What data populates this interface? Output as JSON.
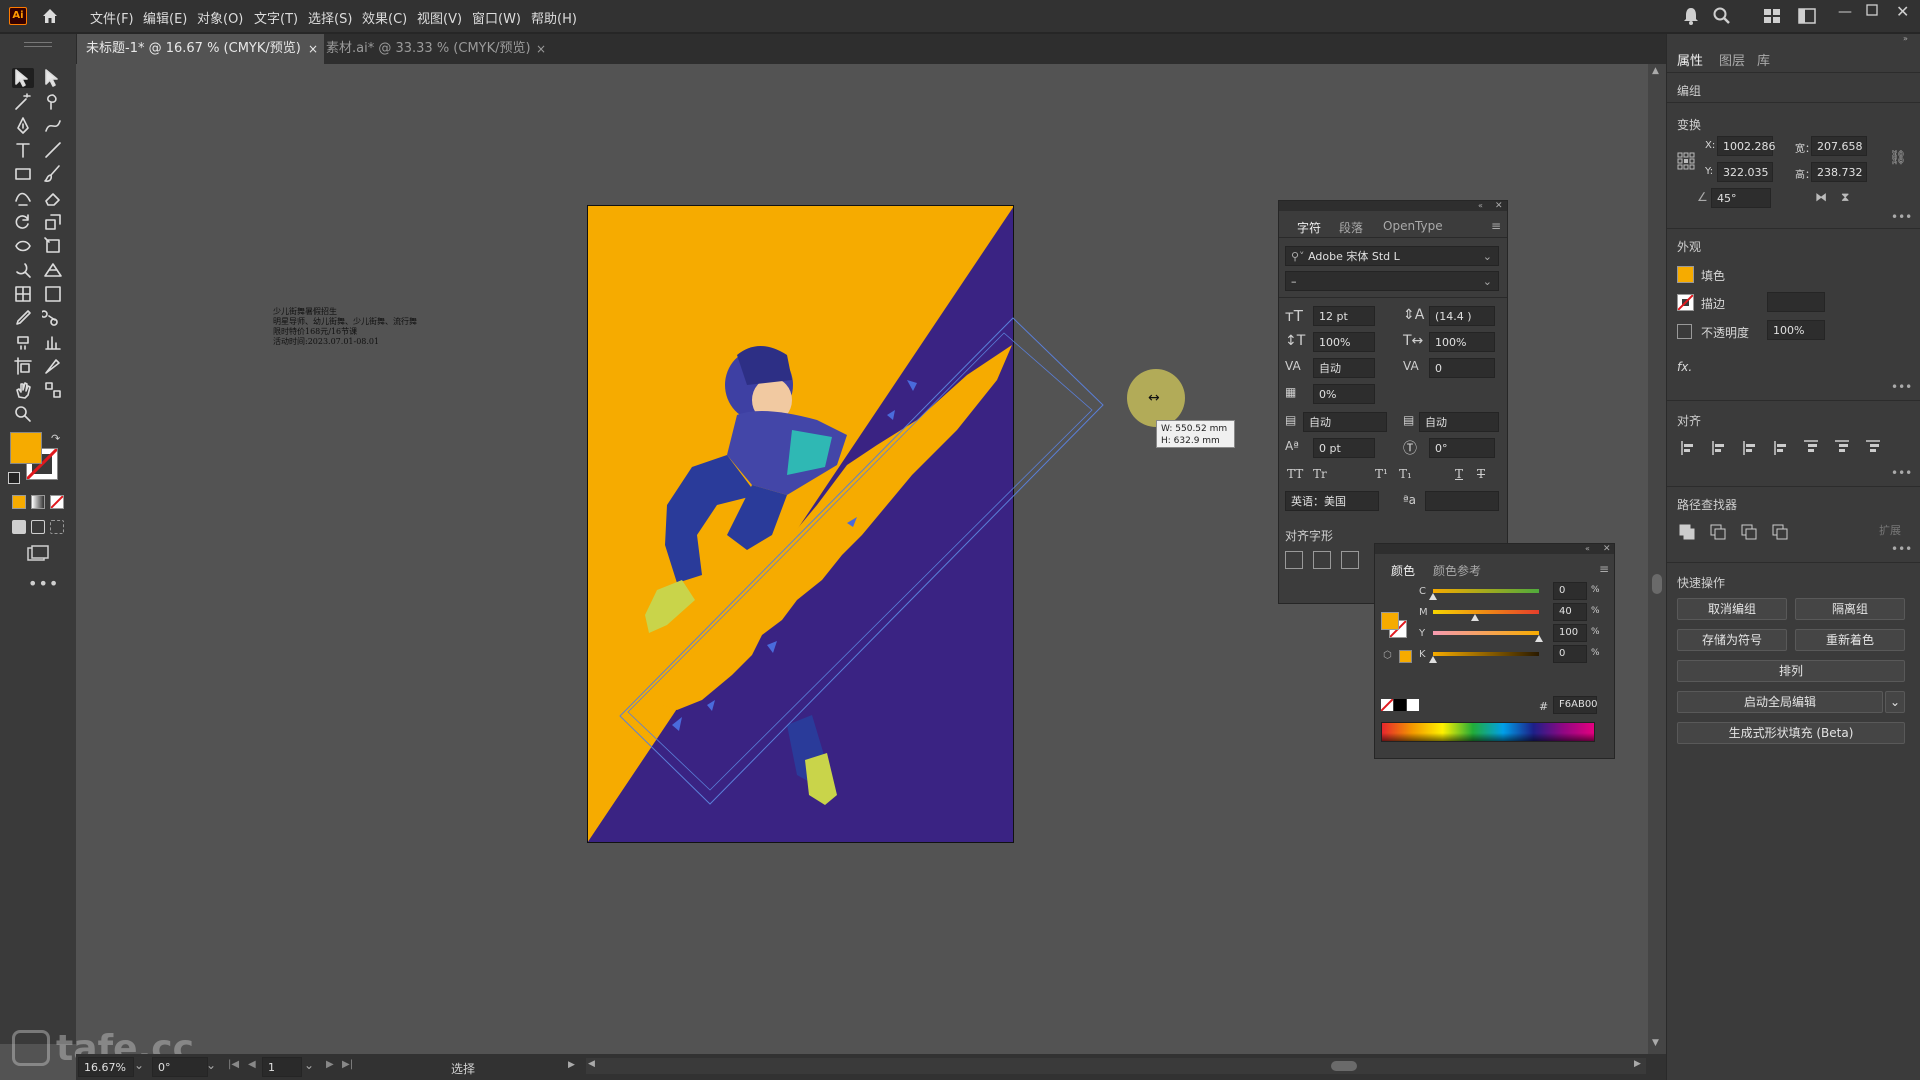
{
  "menu": {
    "app_logo": "Ai",
    "items": [
      "文件(F)",
      "编辑(E)",
      "对象(O)",
      "文字(T)",
      "选择(S)",
      "效果(C)",
      "视图(V)",
      "窗口(W)",
      "帮助(H)"
    ]
  },
  "tabs": [
    {
      "label": "未标题-1* @ 16.67 % (CMYK/预览)",
      "close": "×"
    },
    {
      "label": "素材.ai* @ 33.33 % (CMYK/预览)",
      "close": "×"
    }
  ],
  "canvas": {
    "side_text": [
      "少儿街舞暑假招生",
      "明星导师、幼儿街舞、少儿街舞、流行舞",
      "限时特价168元/16节课",
      "活动时间:2023.07.01-08.01"
    ],
    "size_tooltip": {
      "w": "W: 550.52 mm",
      "h": "H: 632.9 mm"
    },
    "colors": {
      "yellow": "#F6AB00",
      "purple": "#3A2383"
    }
  },
  "character_panel": {
    "tabs": [
      "字符",
      "段落",
      "OpenType"
    ],
    "font_family": "Adobe 宋体 Std L",
    "font_style": "–",
    "size": "12 pt",
    "leading": "(14.4 )",
    "v_scale": "100%",
    "h_scale": "100%",
    "kerning": "自动",
    "tracking": "0",
    "tsume": "0%",
    "aki_left": "自动",
    "aki_right": "自动",
    "baseline": "0 pt",
    "rotation": "0°",
    "language": "英语：美国",
    "align_glyph_label": "对齐字形"
  },
  "color_panel": {
    "tabs": [
      "颜色",
      "颜色参考"
    ],
    "channels": [
      {
        "name": "C",
        "value": "0",
        "unit": "%"
      },
      {
        "name": "M",
        "value": "40",
        "unit": "%"
      },
      {
        "name": "Y",
        "value": "100",
        "unit": "%"
      },
      {
        "name": "K",
        "value": "0",
        "unit": "%"
      }
    ],
    "hex_label": "#",
    "hex": "F6AB00"
  },
  "properties": {
    "tabs": [
      "属性",
      "图层",
      "库"
    ],
    "group_label": "编组",
    "transform_label": "变换",
    "x_label": "X:",
    "x": "1002.286",
    "y_label": "Y:",
    "y": "322.035",
    "w_label": "宽：",
    "w": "207.658",
    "h_label": "高：",
    "h": "238.732",
    "angle": "45°",
    "appearance_label": "外观",
    "fill_label": "填色",
    "stroke_label": "描边",
    "opacity_label": "不透明度",
    "opacity": "100%",
    "fx_label": "fx.",
    "align_label": "对齐",
    "pathfinder_label": "路径查找器",
    "expand_label": "扩展",
    "quick_actions_label": "快速操作",
    "ungroup": "取消编组",
    "isolate": "隔离组",
    "save_symbol": "存储为符号",
    "recolor": "重新着色",
    "arrange": "排列",
    "global_edit": "启动全局编辑",
    "gen_fill": "生成式形状填充 (Beta)"
  },
  "status": {
    "zoom": "16.67%",
    "rotation": "0°",
    "artboard": "1",
    "mode": "选择"
  },
  "watermark": "tafe.cc"
}
